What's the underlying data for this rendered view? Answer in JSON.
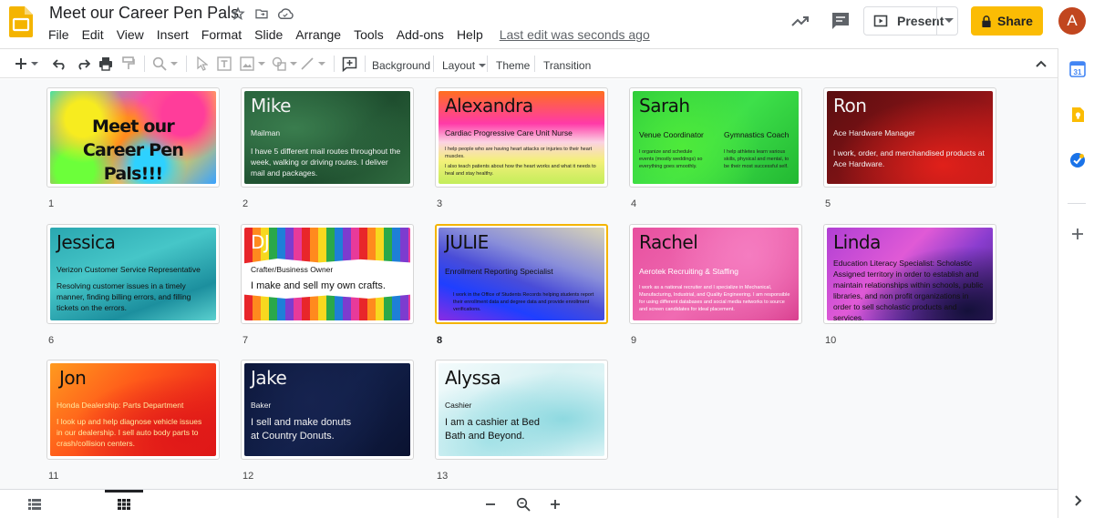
{
  "app": {
    "title": "Meet our Career Pen Pals",
    "menu": [
      "File",
      "Edit",
      "View",
      "Insert",
      "Format",
      "Slide",
      "Arrange",
      "Tools",
      "Add-ons",
      "Help"
    ],
    "last_edit": "Last edit was seconds ago",
    "present_label": "Present",
    "share_label": "Share",
    "avatar_letter": "A"
  },
  "toolbar": {
    "background_label": "Background",
    "layout_label": "Layout",
    "theme_label": "Theme",
    "transition_label": "Transition"
  },
  "slides": [
    {
      "number": "1",
      "title": "Meet our Career Pen Pals!!!"
    },
    {
      "number": "2",
      "name": "Mike",
      "role": "Mailman",
      "desc": "I have 5 different mail routes throughout the week, walking or driving routes. I deliver mail and packages."
    },
    {
      "number": "3",
      "name": "Alexandra",
      "role": "Cardiac Progressive Care Unit Nurse",
      "desc": "I help people who are having heart attacks or injuries to their heart muscles.",
      "desc2": "I also teach patients about how the heart works and what it needs to heal and stay healthy."
    },
    {
      "number": "4",
      "name": "Sarah",
      "role": "Venue Coordinator",
      "role2": "Gymnastics Coach",
      "desc": "I organize and schedule events (mostly weddings) so everything goes smoothly.",
      "desc2": "I help athletes learn various skills, physical and mental, to be their most successful self."
    },
    {
      "number": "5",
      "name": "Ron",
      "role": "Ace Hardware Manager",
      "desc": "I work, order, and merchandised products at Ace Hardware."
    },
    {
      "number": "6",
      "name": "Jessica",
      "role": "Verizon Customer Service Representative",
      "desc": "Resolving customer issues in a timely manner, finding billing errors, and filling tickets on the errors."
    },
    {
      "number": "7",
      "name": "DJ",
      "role": "Crafter/Business Owner",
      "desc": "I make and sell my own crafts."
    },
    {
      "number": "8",
      "name": "JULIE",
      "role": "Enrollment Reporting Specialist",
      "desc": "I work in the Office of Students Records helping students report their enrollment data and degree data and provide enrollment verifications."
    },
    {
      "number": "9",
      "name": "Rachel",
      "role": "Aerotek Recruiting & Staffing",
      "desc": "I work as a national recruiter and I specialize in Mechanical, Manufacturing, Industrial, and Quality Engineering. I am responsible for using different databases and social media networks to source and screen candidates for ideal placement."
    },
    {
      "number": "10",
      "name": "Linda",
      "role": "Education Literacy Specialist: Scholastic",
      "desc": "Assigned territory in order to establish and maintain relationships within schools, public libraries, and non profit organizations in order to sell scholastic products and services."
    },
    {
      "number": "11",
      "name": "Jon",
      "role": "Honda Dealership: Parts Department",
      "desc": "I look up and help diagnose vehicle issues in our dealership. I sell auto body parts to crash/collision centers."
    },
    {
      "number": "12",
      "name": "Jake",
      "role": "Baker",
      "desc": "I sell and make donuts at Country Donuts."
    },
    {
      "number": "13",
      "name": "Alyssa",
      "role": "Cashier",
      "desc": "I am a cashier at Bed Bath and Beyond."
    }
  ],
  "colors": {
    "accent": "#fbbc04",
    "selected_border": "#f4b400",
    "avatar": "#c1461f",
    "slides_logo": "#f4b400"
  }
}
